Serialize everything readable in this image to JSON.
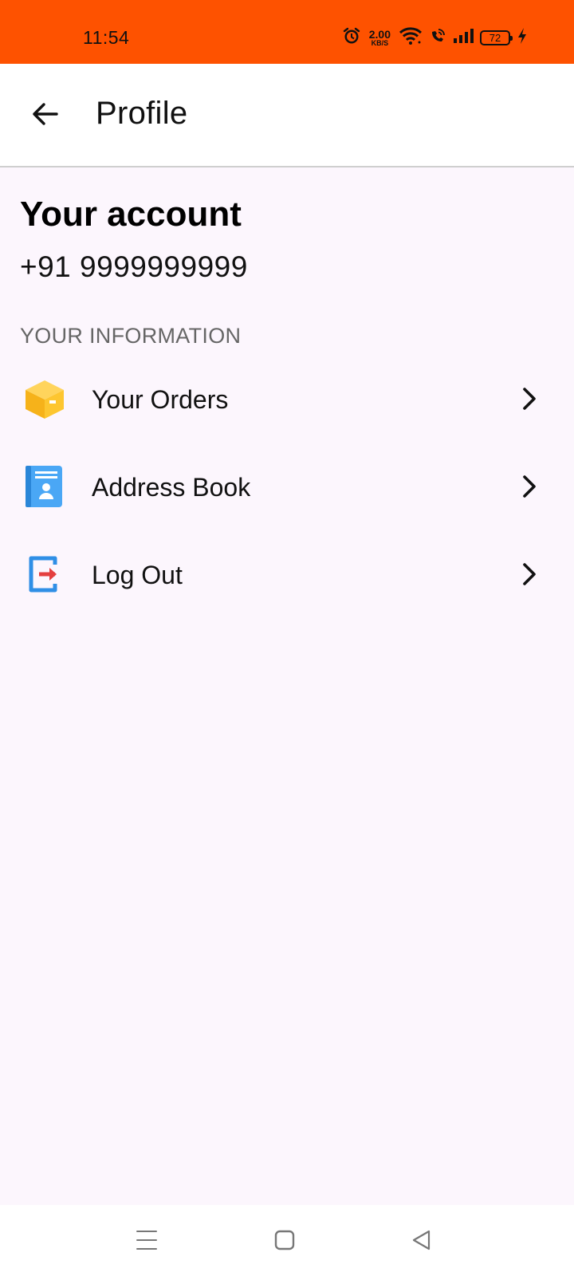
{
  "status_bar": {
    "time": "11:54",
    "net_speed_value": "2.00",
    "net_speed_unit": "KB/S",
    "battery_level": "72",
    "icons": [
      "alarm-icon",
      "wifi-icon",
      "wifi-calling-icon",
      "signal-icon",
      "battery-icon",
      "charging-icon"
    ],
    "background_color": "#fe5200"
  },
  "app_bar": {
    "title": "Profile",
    "back_icon": "arrow-left-icon"
  },
  "account": {
    "heading": "Your account",
    "phone": "+91 9999999999"
  },
  "section": {
    "label": "YOUR INFORMATION"
  },
  "menu": [
    {
      "label": "Your Orders",
      "icon": "package-box-icon",
      "color": "#fdbb2f"
    },
    {
      "label": "Address Book",
      "icon": "address-book-icon",
      "color": "#3d9df3"
    },
    {
      "label": "Log Out",
      "icon": "logout-icon",
      "color": "#e43f3f"
    }
  ],
  "nav_bar": {
    "buttons": [
      "menu-lines-icon",
      "home-square-icon",
      "back-triangle-icon"
    ]
  }
}
